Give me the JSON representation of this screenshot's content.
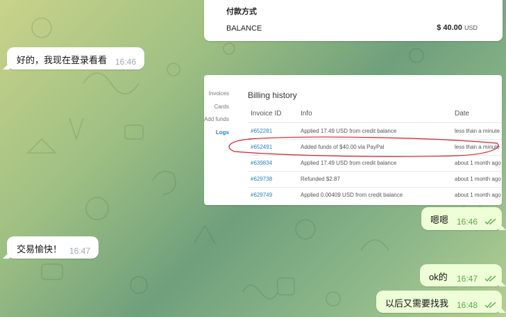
{
  "payment_card": {
    "title": "付款方式",
    "label": "BALANCE",
    "amount": "$ 40.00",
    "currency": "USD"
  },
  "billing": {
    "sidebar": [
      "Invoices",
      "Cards",
      "Add funds",
      "Logs"
    ],
    "active_sidebar": "Logs",
    "title": "Billing history",
    "columns": [
      "Invoice ID",
      "Info",
      "Date"
    ],
    "rows": [
      {
        "id": "#652281",
        "info": "Applied 17.49 USD from credit balance",
        "date": "less than a minute"
      },
      {
        "id": "#652491",
        "info": "Added funds of $40.00 via PayPal",
        "date": "less than a minute"
      },
      {
        "id": "#639834",
        "info": "Applied 17.49 USD from credit balance",
        "date": "about 1 month ago"
      },
      {
        "id": "#629738",
        "info": "Refunded $2.87",
        "date": "about 1 month ago"
      },
      {
        "id": "#629749",
        "info": "Applied 0.00409 USD from credit balance",
        "date": "about 1 month ago"
      }
    ],
    "highlight_color": "#d0202a"
  },
  "messages": [
    {
      "text": "好的，我现在登录看看",
      "time": "16:46",
      "dir": "in"
    },
    {
      "text": "嗯嗯",
      "time": "16:46",
      "dir": "out"
    },
    {
      "text": "交易愉快！",
      "time": "16:47",
      "dir": "in"
    },
    {
      "text": "ok的",
      "time": "16:47",
      "dir": "out"
    },
    {
      "text": "以后又需要找我",
      "time": "16:48",
      "dir": "out"
    }
  ],
  "colors": {
    "incoming_bubble": "#ffffff",
    "outgoing_bubble": "#eefed7",
    "outgoing_time": "#5da54c",
    "link": "#2a7fc0"
  },
  "icons": {
    "read_receipt": "double-check-icon"
  }
}
